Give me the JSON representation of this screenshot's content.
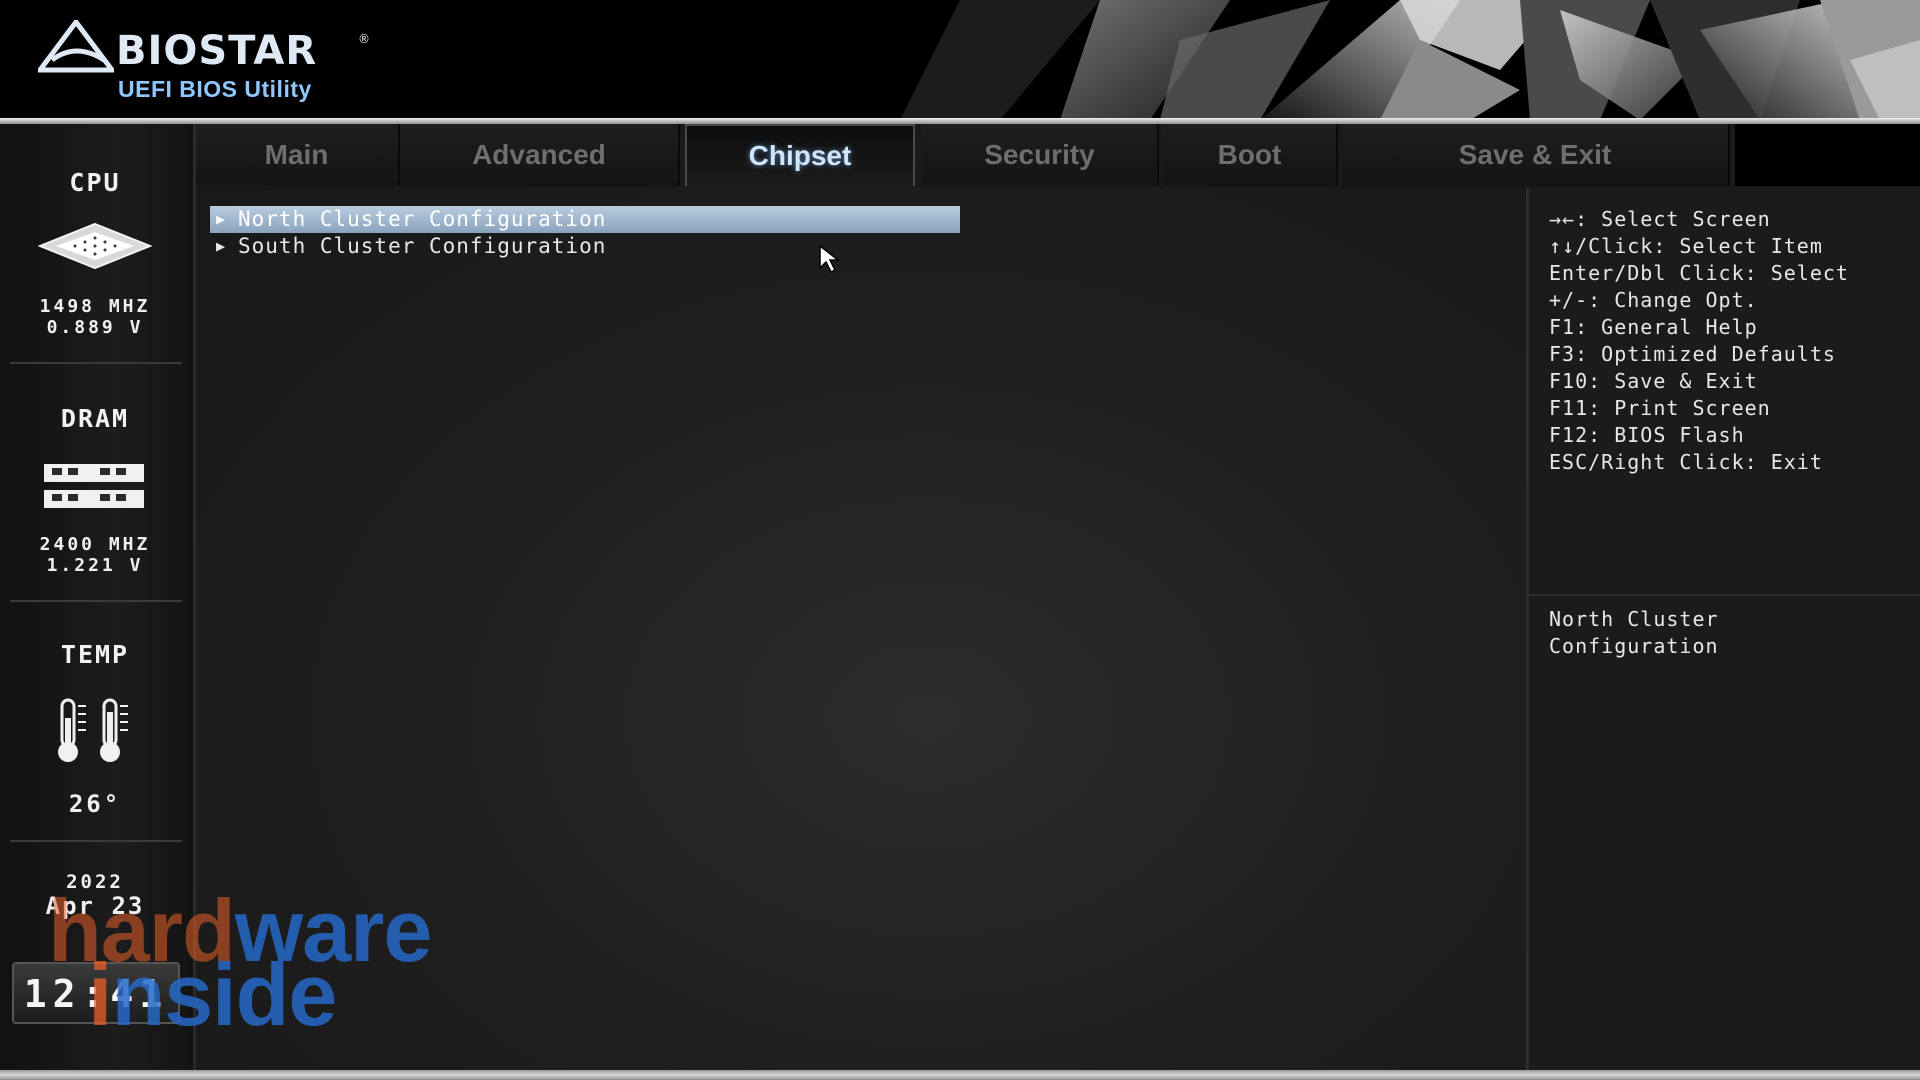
{
  "header": {
    "brand": "BIOSTAR",
    "subtitle": "UEFI BIOS Utility"
  },
  "tabs": [
    {
      "label": "Main",
      "active": false
    },
    {
      "label": "Advanced",
      "active": false
    },
    {
      "label": "Chipset",
      "active": true
    },
    {
      "label": "Security",
      "active": false
    },
    {
      "label": "Boot",
      "active": false
    },
    {
      "label": "Save & Exit",
      "active": false
    }
  ],
  "sidebar": {
    "cpu": {
      "title": "CPU",
      "freq": "1498 MHZ",
      "volt": "0.889 V",
      "icon": "cpu-chip-icon"
    },
    "dram": {
      "title": "DRAM",
      "freq": "2400 MHZ",
      "volt": "1.221 V",
      "icon": "memory-module-icon"
    },
    "temp": {
      "title": "TEMP",
      "value": "26°",
      "icon": "thermometer-icon"
    },
    "date": {
      "year": "2022",
      "month_day": "Apr 23"
    },
    "clock": "12:41"
  },
  "menu": {
    "items": [
      {
        "label": "North Cluster Configuration",
        "selected": true
      },
      {
        "label": "South Cluster Configuration",
        "selected": false
      }
    ]
  },
  "help": {
    "keys": [
      "→←: Select Screen",
      "↑↓/Click: Select Item",
      "Enter/Dbl Click: Select",
      "+/-: Change Opt.",
      "F1: General Help",
      "F3: Optimized Defaults",
      "F10: Save & Exit",
      "F11: Print Screen",
      "F12: BIOS Flash",
      "ESC/Right Click: Exit"
    ],
    "description_lines": [
      "North Cluster",
      "Configuration"
    ]
  },
  "watermark": {
    "line1_a": "hard",
    "line1_b": "ware",
    "line2_a": "i",
    "line2_b": "nside"
  },
  "colors": {
    "selection": "#9fb6cf",
    "active_tab_text": "#cfe6ff",
    "logo_blue": "#8fc7ff"
  }
}
